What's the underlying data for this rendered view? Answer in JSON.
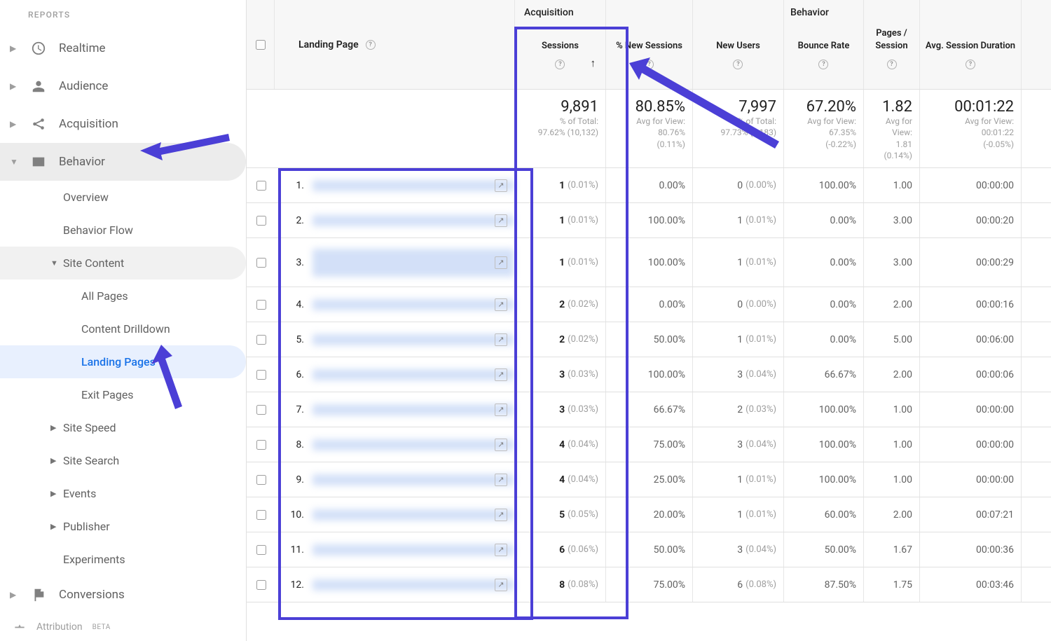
{
  "sidebar": {
    "section_title": "REPORTS",
    "items": [
      {
        "label": "Realtime",
        "icon": "clock"
      },
      {
        "label": "Audience",
        "icon": "person"
      },
      {
        "label": "Acquisition",
        "icon": "share"
      },
      {
        "label": "Behavior",
        "icon": "browser",
        "open": true
      },
      {
        "label": "Conversions",
        "icon": "flag"
      }
    ],
    "behavior_children": [
      {
        "label": "Overview"
      },
      {
        "label": "Behavior Flow"
      },
      {
        "label": "Site Content",
        "open": true,
        "children": [
          {
            "label": "All Pages"
          },
          {
            "label": "Content Drilldown"
          },
          {
            "label": "Landing Pages",
            "active": true
          },
          {
            "label": "Exit Pages"
          }
        ]
      },
      {
        "label": "Site Speed",
        "caret": true
      },
      {
        "label": "Site Search",
        "caret": true
      },
      {
        "label": "Events",
        "caret": true
      },
      {
        "label": "Publisher",
        "caret": true
      },
      {
        "label": "Experiments"
      }
    ],
    "attribution": {
      "label": "Attribution",
      "badge": "BETA"
    }
  },
  "table": {
    "groups": {
      "acquisition": "Acquisition",
      "behavior": "Behavior"
    },
    "landing_page_header": "Landing Page",
    "columns": [
      {
        "key": "sessions",
        "label": "Sessions",
        "sorted": true
      },
      {
        "key": "pctnew",
        "label": "% New Sessions"
      },
      {
        "key": "newusers",
        "label": "New Users"
      },
      {
        "key": "bounce",
        "label": "Bounce Rate"
      },
      {
        "key": "pps",
        "label": "Pages / Session"
      },
      {
        "key": "dur",
        "label": "Avg. Session Duration"
      }
    ],
    "summary": {
      "sessions": {
        "main": "9,891",
        "sub1": "% of Total:",
        "sub2": "97.62% (10,132)"
      },
      "pctnew": {
        "main": "80.85%",
        "sub1": "Avg for View:",
        "sub2": "80.76%",
        "sub3": "(0.11%)"
      },
      "newusers": {
        "main": "7,997",
        "sub1": "% of Total:",
        "sub2": "97.73% (8,183)"
      },
      "bounce": {
        "main": "67.20%",
        "sub1": "Avg for View:",
        "sub2": "67.35%",
        "sub3": "(-0.22%)"
      },
      "pps": {
        "main": "1.82",
        "sub1": "Avg for",
        "sub2": "View:",
        "sub3": "1.81",
        "sub4": "(0.14%)"
      },
      "dur": {
        "main": "00:01:22",
        "sub1": "Avg for View:",
        "sub2": "00:01:22",
        "sub3": "(-0.05%)"
      }
    },
    "rows": [
      {
        "n": "1.",
        "sessions": "1",
        "spct": "(0.01%)",
        "pctnew": "0.00%",
        "nu": "0",
        "nupct": "(0.00%)",
        "bounce": "100.00%",
        "pps": "1.00",
        "dur": "00:00:00"
      },
      {
        "n": "2.",
        "sessions": "1",
        "spct": "(0.01%)",
        "pctnew": "100.00%",
        "nu": "1",
        "nupct": "(0.01%)",
        "bounce": "0.00%",
        "pps": "3.00",
        "dur": "00:00:20"
      },
      {
        "n": "3.",
        "sessions": "1",
        "spct": "(0.01%)",
        "pctnew": "100.00%",
        "nu": "1",
        "nupct": "(0.01%)",
        "bounce": "0.00%",
        "pps": "3.00",
        "dur": "00:00:29",
        "tall": true
      },
      {
        "n": "4.",
        "sessions": "2",
        "spct": "(0.02%)",
        "pctnew": "0.00%",
        "nu": "0",
        "nupct": "(0.00%)",
        "bounce": "0.00%",
        "pps": "2.00",
        "dur": "00:00:16"
      },
      {
        "n": "5.",
        "sessions": "2",
        "spct": "(0.02%)",
        "pctnew": "50.00%",
        "nu": "1",
        "nupct": "(0.01%)",
        "bounce": "0.00%",
        "pps": "5.00",
        "dur": "00:06:00"
      },
      {
        "n": "6.",
        "sessions": "3",
        "spct": "(0.03%)",
        "pctnew": "100.00%",
        "nu": "3",
        "nupct": "(0.04%)",
        "bounce": "66.67%",
        "pps": "2.00",
        "dur": "00:00:06"
      },
      {
        "n": "7.",
        "sessions": "3",
        "spct": "(0.03%)",
        "pctnew": "66.67%",
        "nu": "2",
        "nupct": "(0.03%)",
        "bounce": "100.00%",
        "pps": "1.00",
        "dur": "00:00:00"
      },
      {
        "n": "8.",
        "sessions": "4",
        "spct": "(0.04%)",
        "pctnew": "75.00%",
        "nu": "3",
        "nupct": "(0.04%)",
        "bounce": "100.00%",
        "pps": "1.00",
        "dur": "00:00:00"
      },
      {
        "n": "9.",
        "sessions": "4",
        "spct": "(0.04%)",
        "pctnew": "25.00%",
        "nu": "1",
        "nupct": "(0.01%)",
        "bounce": "100.00%",
        "pps": "1.00",
        "dur": "00:00:00"
      },
      {
        "n": "10.",
        "sessions": "5",
        "spct": "(0.05%)",
        "pctnew": "20.00%",
        "nu": "1",
        "nupct": "(0.01%)",
        "bounce": "60.00%",
        "pps": "2.00",
        "dur": "00:07:21"
      },
      {
        "n": "11.",
        "sessions": "6",
        "spct": "(0.06%)",
        "pctnew": "50.00%",
        "nu": "3",
        "nupct": "(0.04%)",
        "bounce": "50.00%",
        "pps": "1.67",
        "dur": "00:00:36"
      },
      {
        "n": "12.",
        "sessions": "8",
        "spct": "(0.08%)",
        "pctnew": "75.00%",
        "nu": "6",
        "nupct": "(0.08%)",
        "bounce": "87.50%",
        "pps": "1.75",
        "dur": "00:03:46"
      }
    ]
  }
}
